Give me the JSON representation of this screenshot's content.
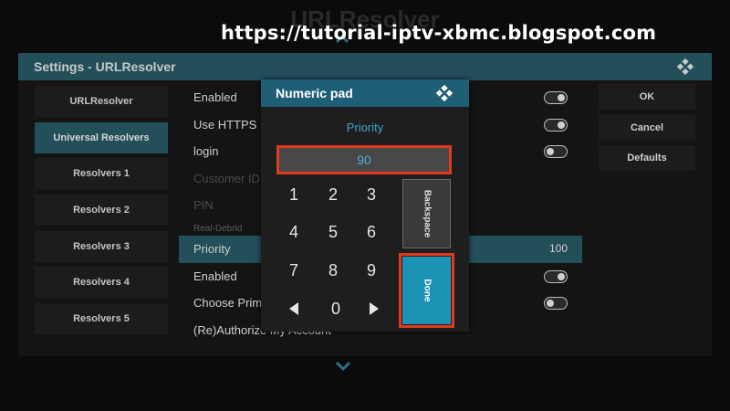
{
  "background_title": "URLResolver",
  "watermark": "https://tutorial-iptv-xbmc.blogspot.com",
  "settings": {
    "title": "Settings - URLResolver",
    "categories": [
      "URLResolver",
      "Universal Resolvers",
      "Resolvers 1",
      "Resolvers 2",
      "Resolvers 3",
      "Resolvers 4",
      "Resolvers 5"
    ],
    "active_category": "Universal Resolvers",
    "rows": {
      "enabled1": "Enabled",
      "use_https": "Use HTTPS",
      "login": "login",
      "customer_id": "Customer ID",
      "pin": "PIN",
      "section_real_debrid": "Real-Debrid",
      "priority": "Priority",
      "priority_value": "100",
      "enabled2": "Enabled",
      "choose_primary": "Choose Primary",
      "reauthorize": "(Re)Authorize My Account"
    },
    "toggles": {
      "enabled1": true,
      "use_https": true,
      "login": false,
      "enabled2": true,
      "choose_primary": false
    },
    "buttons": {
      "ok": "OK",
      "cancel": "Cancel",
      "defaults": "Defaults"
    }
  },
  "numpad": {
    "title": "Numeric pad",
    "label": "Priority",
    "input_value": "90",
    "keys": {
      "k1": "1",
      "k2": "2",
      "k3": "3",
      "k4": "4",
      "k5": "5",
      "k6": "6",
      "k7": "7",
      "k8": "8",
      "k9": "9",
      "k0": "0"
    },
    "backspace": "Backspace",
    "done": "Done"
  },
  "colors": {
    "header_teal": "#234f5a",
    "pad_header": "#1f5f76",
    "accent_blue": "#1c93b5",
    "highlight_red": "#e03a1e"
  }
}
